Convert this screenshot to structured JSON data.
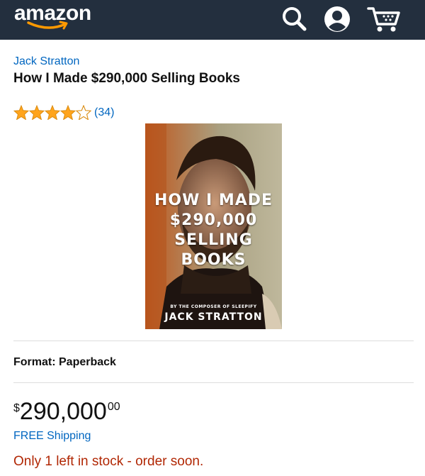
{
  "header": {
    "logo_text": "amazon",
    "background": "#232f3e",
    "icons": [
      "search-icon",
      "account-icon",
      "cart-icon"
    ]
  },
  "product": {
    "author": "Jack Stratton",
    "title": "How I Made $290,000 Selling Books",
    "rating": {
      "stars": 4,
      "max": 5,
      "count": "(34)"
    },
    "cover": {
      "title_lines": [
        "HOW I MADE",
        "$290,000",
        "SELLING",
        "BOOKS"
      ],
      "byline": "BY THE COMPOSER OF SLEEPIFY",
      "author": "JACK STRATTON"
    },
    "format_label": "Format: Paperback",
    "price": {
      "symbol": "$",
      "whole": "290,000",
      "fraction": "00"
    },
    "shipping": "FREE Shipping",
    "stock": "Only 1 left in stock - order soon."
  },
  "colors": {
    "link": "#0066c0",
    "star": "#ffa41c",
    "stock_warning": "#b12704",
    "accent": "#ff9900"
  }
}
